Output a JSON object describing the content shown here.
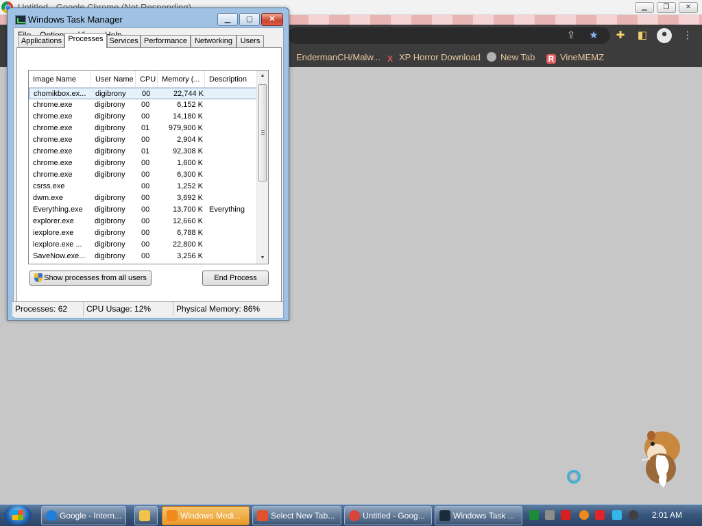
{
  "chrome": {
    "window_title": "Untitled - Google Chrome (Not Responding)",
    "bookmarks": [
      "EndermanCH/Malw...",
      "XP Horror Download",
      "New Tab",
      "VineMEMZ"
    ]
  },
  "task_manager": {
    "title": "Windows Task Manager",
    "menu": [
      "File",
      "Options",
      "View",
      "Help"
    ],
    "tabs": [
      "Applications",
      "Processes",
      "Services",
      "Performance",
      "Networking",
      "Users"
    ],
    "active_tab": "Processes",
    "columns": [
      "Image Name",
      "User Name",
      "CPU",
      "Memory (...",
      "Description"
    ],
    "sort_column": "Image Name",
    "processes": [
      {
        "name": "chomikbox.ex...",
        "user": "digibrony",
        "cpu": "00",
        "memory": "22,744 K",
        "description": ""
      },
      {
        "name": "chrome.exe",
        "user": "digibrony",
        "cpu": "00",
        "memory": "6,152 K",
        "description": ""
      },
      {
        "name": "chrome.exe",
        "user": "digibrony",
        "cpu": "00",
        "memory": "14,180 K",
        "description": ""
      },
      {
        "name": "chrome.exe",
        "user": "digibrony",
        "cpu": "01",
        "memory": "979,900 K",
        "description": ""
      },
      {
        "name": "chrome.exe",
        "user": "digibrony",
        "cpu": "00",
        "memory": "2,904 K",
        "description": ""
      },
      {
        "name": "chrome.exe",
        "user": "digibrony",
        "cpu": "01",
        "memory": "92,308 K",
        "description": ""
      },
      {
        "name": "chrome.exe",
        "user": "digibrony",
        "cpu": "00",
        "memory": "1,600 K",
        "description": ""
      },
      {
        "name": "chrome.exe",
        "user": "digibrony",
        "cpu": "00",
        "memory": "6,300 K",
        "description": ""
      },
      {
        "name": "csrss.exe",
        "user": "",
        "cpu": "00",
        "memory": "1,252 K",
        "description": ""
      },
      {
        "name": "dwm.exe",
        "user": "digibrony",
        "cpu": "00",
        "memory": "3,692 K",
        "description": ""
      },
      {
        "name": "Everything.exe",
        "user": "digibrony",
        "cpu": "00",
        "memory": "13,700 K",
        "description": "Everything"
      },
      {
        "name": "explorer.exe",
        "user": "digibrony",
        "cpu": "00",
        "memory": "12,660 K",
        "description": ""
      },
      {
        "name": "iexplore.exe",
        "user": "digibrony",
        "cpu": "00",
        "memory": "6,788 K",
        "description": ""
      },
      {
        "name": "iexplore.exe ...",
        "user": "digibrony",
        "cpu": "00",
        "memory": "22,800 K",
        "description": ""
      },
      {
        "name": "SaveNow.exe...",
        "user": "digibrony",
        "cpu": "00",
        "memory": "3,256 K",
        "description": ""
      }
    ],
    "selected_row": 0,
    "show_all_button": "Show processes from all users",
    "end_process_button": "End Process",
    "status": {
      "processes": "Processes: 62",
      "cpu": "CPU Usage: 12%",
      "memory": "Physical Memory: 86%"
    }
  },
  "taskbar": {
    "buttons": [
      {
        "label": "Google - Intern...",
        "icon": "ie-icon",
        "color": "#1e7fd8",
        "active": false
      },
      {
        "label": "",
        "icon": "folder-icon",
        "color": "#f0c24a",
        "active": false
      },
      {
        "label": "Windows Medi...",
        "icon": "media-player-icon",
        "color": "#f28a1b",
        "active": true
      },
      {
        "label": "Select New Tab...",
        "icon": "app-icon",
        "color": "#e0522d",
        "active": false
      },
      {
        "label": "Untitled - Goog...",
        "icon": "chrome-icon",
        "color": "#db4437",
        "active": false
      },
      {
        "label": "Windows Task ...",
        "icon": "task-manager-icon",
        "color": "#1b2c3a",
        "active": false
      }
    ],
    "tray_icons": [
      {
        "name": "tray-green-icon",
        "color": "#1d8a3a"
      },
      {
        "name": "tray-network-icon",
        "color": "#8d8d8d"
      },
      {
        "name": "tray-v-icon",
        "color": "#d81e1e"
      },
      {
        "name": "tray-search-icon",
        "color": "#f08a1a"
      },
      {
        "name": "tray-flag-icon",
        "color": "#e0242a"
      },
      {
        "name": "tray-monitor-icon",
        "color": "#35b6e8"
      },
      {
        "name": "tray-volume-icon",
        "color": "#404040"
      }
    ],
    "clock": "2:01 AM"
  }
}
